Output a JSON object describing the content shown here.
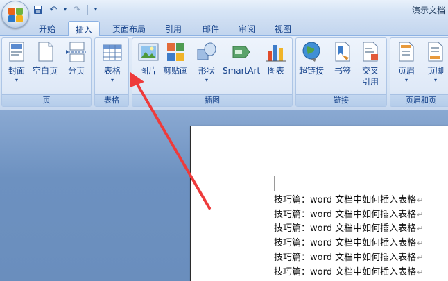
{
  "window": {
    "doc_title": "演示文档"
  },
  "qat": {
    "save": "save-icon",
    "undo": "↶",
    "undo_dd": "▾",
    "redo": "↷",
    "customize": "▾"
  },
  "tabs": [
    {
      "label": "开始"
    },
    {
      "label": "插入"
    },
    {
      "label": "页面布局"
    },
    {
      "label": "引用"
    },
    {
      "label": "邮件"
    },
    {
      "label": "审阅"
    },
    {
      "label": "视图"
    }
  ],
  "groups": {
    "pages": {
      "label": "页",
      "buttons": [
        "封面",
        "空白页",
        "分页"
      ]
    },
    "tables": {
      "label": "表格",
      "buttons": [
        "表格"
      ]
    },
    "illustrations": {
      "label": "插图",
      "buttons": [
        "图片",
        "剪贴画",
        "形状",
        "SmartArt",
        "图表"
      ]
    },
    "links": {
      "label": "链接",
      "buttons": [
        "超链接",
        "书签",
        "交叉",
        "引用"
      ]
    },
    "header_footer": {
      "label": "页眉和页",
      "buttons": [
        "页眉",
        "页脚"
      ]
    }
  },
  "dropdown_glyph": "▾",
  "document": {
    "lines": [
      "技巧篇：word 文档中如何插入表格",
      "技巧篇：word 文档中如何插入表格",
      "技巧篇：word 文档中如何插入表格",
      "技巧篇：word 文档中如何插入表格",
      "技巧篇：word 文档中如何插入表格",
      "技巧篇：word 文档中如何插入表格"
    ],
    "paragraph_mark": "↵"
  },
  "colors": {
    "accent": "#15428b",
    "arrow": "#ee3b3b"
  }
}
